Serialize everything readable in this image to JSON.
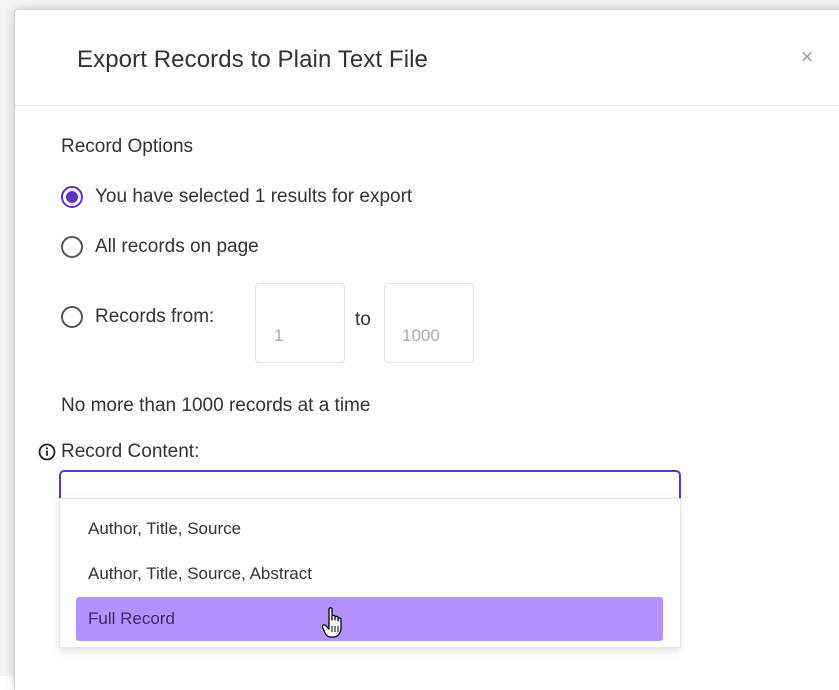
{
  "dialog": {
    "title": "Export Records to Plain Text File",
    "close_glyph": "×"
  },
  "record_options": {
    "label": "Record Options",
    "options": [
      {
        "label": "You have selected 1 results for export",
        "checked": true
      },
      {
        "label": "All records on page",
        "checked": false
      },
      {
        "label": "Records from:",
        "checked": false
      }
    ],
    "range": {
      "from_placeholder": "1",
      "to_label": "to",
      "to_placeholder": "1000"
    },
    "limit_note": "No more than 1000 records at a time"
  },
  "record_content": {
    "label": "Record Content:",
    "info_icon": "info-circle-icon",
    "dropdown_options": [
      {
        "label": "Author, Title, Source",
        "highlighted": false
      },
      {
        "label": "Author, Title, Source, Abstract",
        "highlighted": false
      },
      {
        "label": "Full Record",
        "highlighted": true
      }
    ]
  },
  "colors": {
    "accent": "#5e33bf",
    "highlight": "#b391ff"
  },
  "cursor": "hand-pointer-cursor"
}
